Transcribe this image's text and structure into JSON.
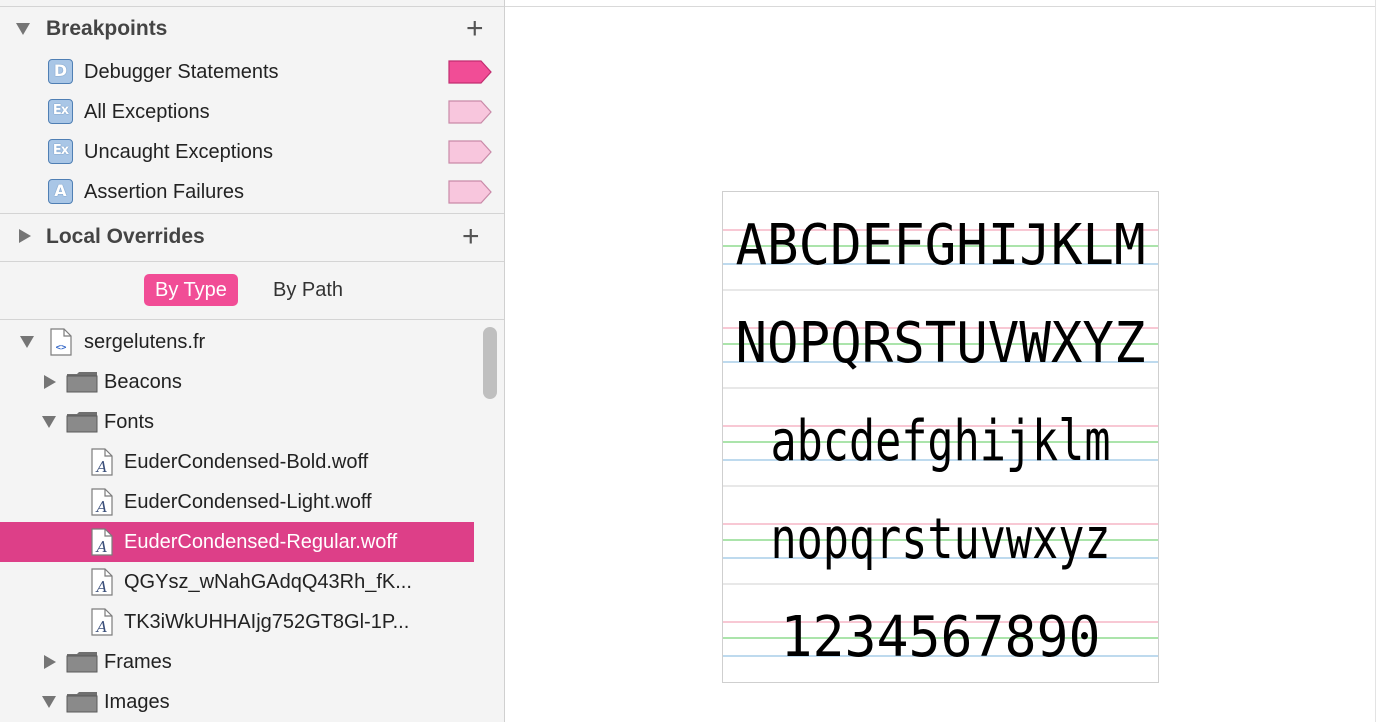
{
  "breakpoints": {
    "title": "Breakpoints",
    "add_icon": "plus-icon",
    "items": [
      {
        "badge": "D",
        "label": "Debugger Statements",
        "active": true
      },
      {
        "badge": "Ex",
        "label": "All Exceptions",
        "active": false
      },
      {
        "badge": "Ex",
        "label": "Uncaught Exceptions",
        "active": false
      },
      {
        "badge": "A",
        "label": "Assertion Failures",
        "active": false
      }
    ]
  },
  "local_overrides": {
    "title": "Local Overrides"
  },
  "view_toggle": {
    "by_type": "By Type",
    "by_path": "By Path"
  },
  "tree": {
    "domain": "sergelutens.fr",
    "folders": {
      "beacons": "Beacons",
      "fonts": "Fonts",
      "frames": "Frames",
      "images": "Images"
    },
    "font_files": [
      "EuderCondensed-Bold.woff",
      "EuderCondensed-Light.woff",
      "EuderCondensed-Regular.woff",
      "QGYsz_wNahGAdqQ43Rh_fK...",
      "TK3iWkUHHAIjg752GT8Gl-1P..."
    ]
  },
  "font_preview": {
    "lines": [
      "ABCDEFGHIJKLM",
      "NOPQRSTUVWXYZ",
      "abcdefghijklm",
      "nopqrstuvwxyz",
      "1234567890"
    ]
  },
  "colors": {
    "accent": "#f14d96",
    "selection": "#dd3f88",
    "flag_active": "#f14d96",
    "flag_inactive": "#f8c6dd",
    "guide_pink": "#f6b6c6",
    "guide_green": "#8fdc8f",
    "guide_blue": "#a9cde8"
  }
}
